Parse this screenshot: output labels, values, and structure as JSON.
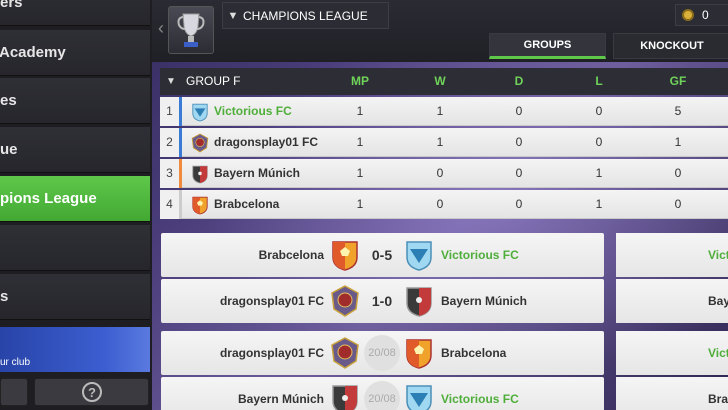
{
  "sidebar": {
    "items": [
      {
        "label": "ers"
      },
      {
        "label": "Academy"
      },
      {
        "label": "es"
      },
      {
        "label": "ue"
      },
      {
        "label": "pions League"
      },
      {
        "label": ""
      },
      {
        "label": "s"
      }
    ],
    "club_text": "ur club",
    "help_label": "?"
  },
  "topbar": {
    "competition": "CHAMPIONS LEAGUE",
    "coins": "0",
    "tabs": [
      {
        "label": "GROUPS",
        "active": true
      },
      {
        "label": "KNOCKOUT",
        "active": false
      }
    ]
  },
  "standings": {
    "group_label": "GROUP F",
    "columns": [
      "MP",
      "W",
      "D",
      "L",
      "GF"
    ],
    "rows": [
      {
        "pos": "1",
        "team": "Victorious FC",
        "mine": true,
        "mp": "1",
        "w": "1",
        "d": "0",
        "l": "0",
        "gf": "5",
        "bar_color": "#3a7bd5"
      },
      {
        "pos": "2",
        "team": "dragonsplay01 FC",
        "mine": false,
        "mp": "1",
        "w": "1",
        "d": "0",
        "l": "0",
        "gf": "1",
        "bar_color": "#3a7bd5"
      },
      {
        "pos": "3",
        "team": "Bayern Múnich",
        "mine": false,
        "mp": "1",
        "w": "0",
        "d": "0",
        "l": "1",
        "gf": "0",
        "bar_color": "#f08a3c"
      },
      {
        "pos": "4",
        "team": "Brabcelona",
        "mine": false,
        "mp": "1",
        "w": "0",
        "d": "0",
        "l": "1",
        "gf": "0",
        "bar_color": "#cccccc"
      }
    ]
  },
  "fixtures": [
    {
      "home": "Brabcelona",
      "home_mine": false,
      "result": "0-5",
      "away": "Victorious FC",
      "away_mine": true,
      "is_date": false
    },
    {
      "home": "dragonsplay01 FC",
      "home_mine": false,
      "result": "1-0",
      "away": "Bayern Múnich",
      "away_mine": false,
      "is_date": false
    },
    {
      "home": "dragonsplay01 FC",
      "home_mine": false,
      "result": "20/08",
      "away": "Brabcelona",
      "away_mine": false,
      "is_date": true
    },
    {
      "home": "Bayern Múnich",
      "home_mine": false,
      "result": "20/08",
      "away": "Victorious FC",
      "away_mine": true,
      "is_date": true
    }
  ],
  "fixtures_right": [
    {
      "name": "Vict",
      "mine": true
    },
    {
      "name": "Baye",
      "mine": false
    },
    {
      "name": "Vict",
      "mine": true
    },
    {
      "name": "Brab",
      "mine": false
    }
  ],
  "colors": {
    "accent": "#5fc84a",
    "mine_text": "#4fae3a"
  }
}
